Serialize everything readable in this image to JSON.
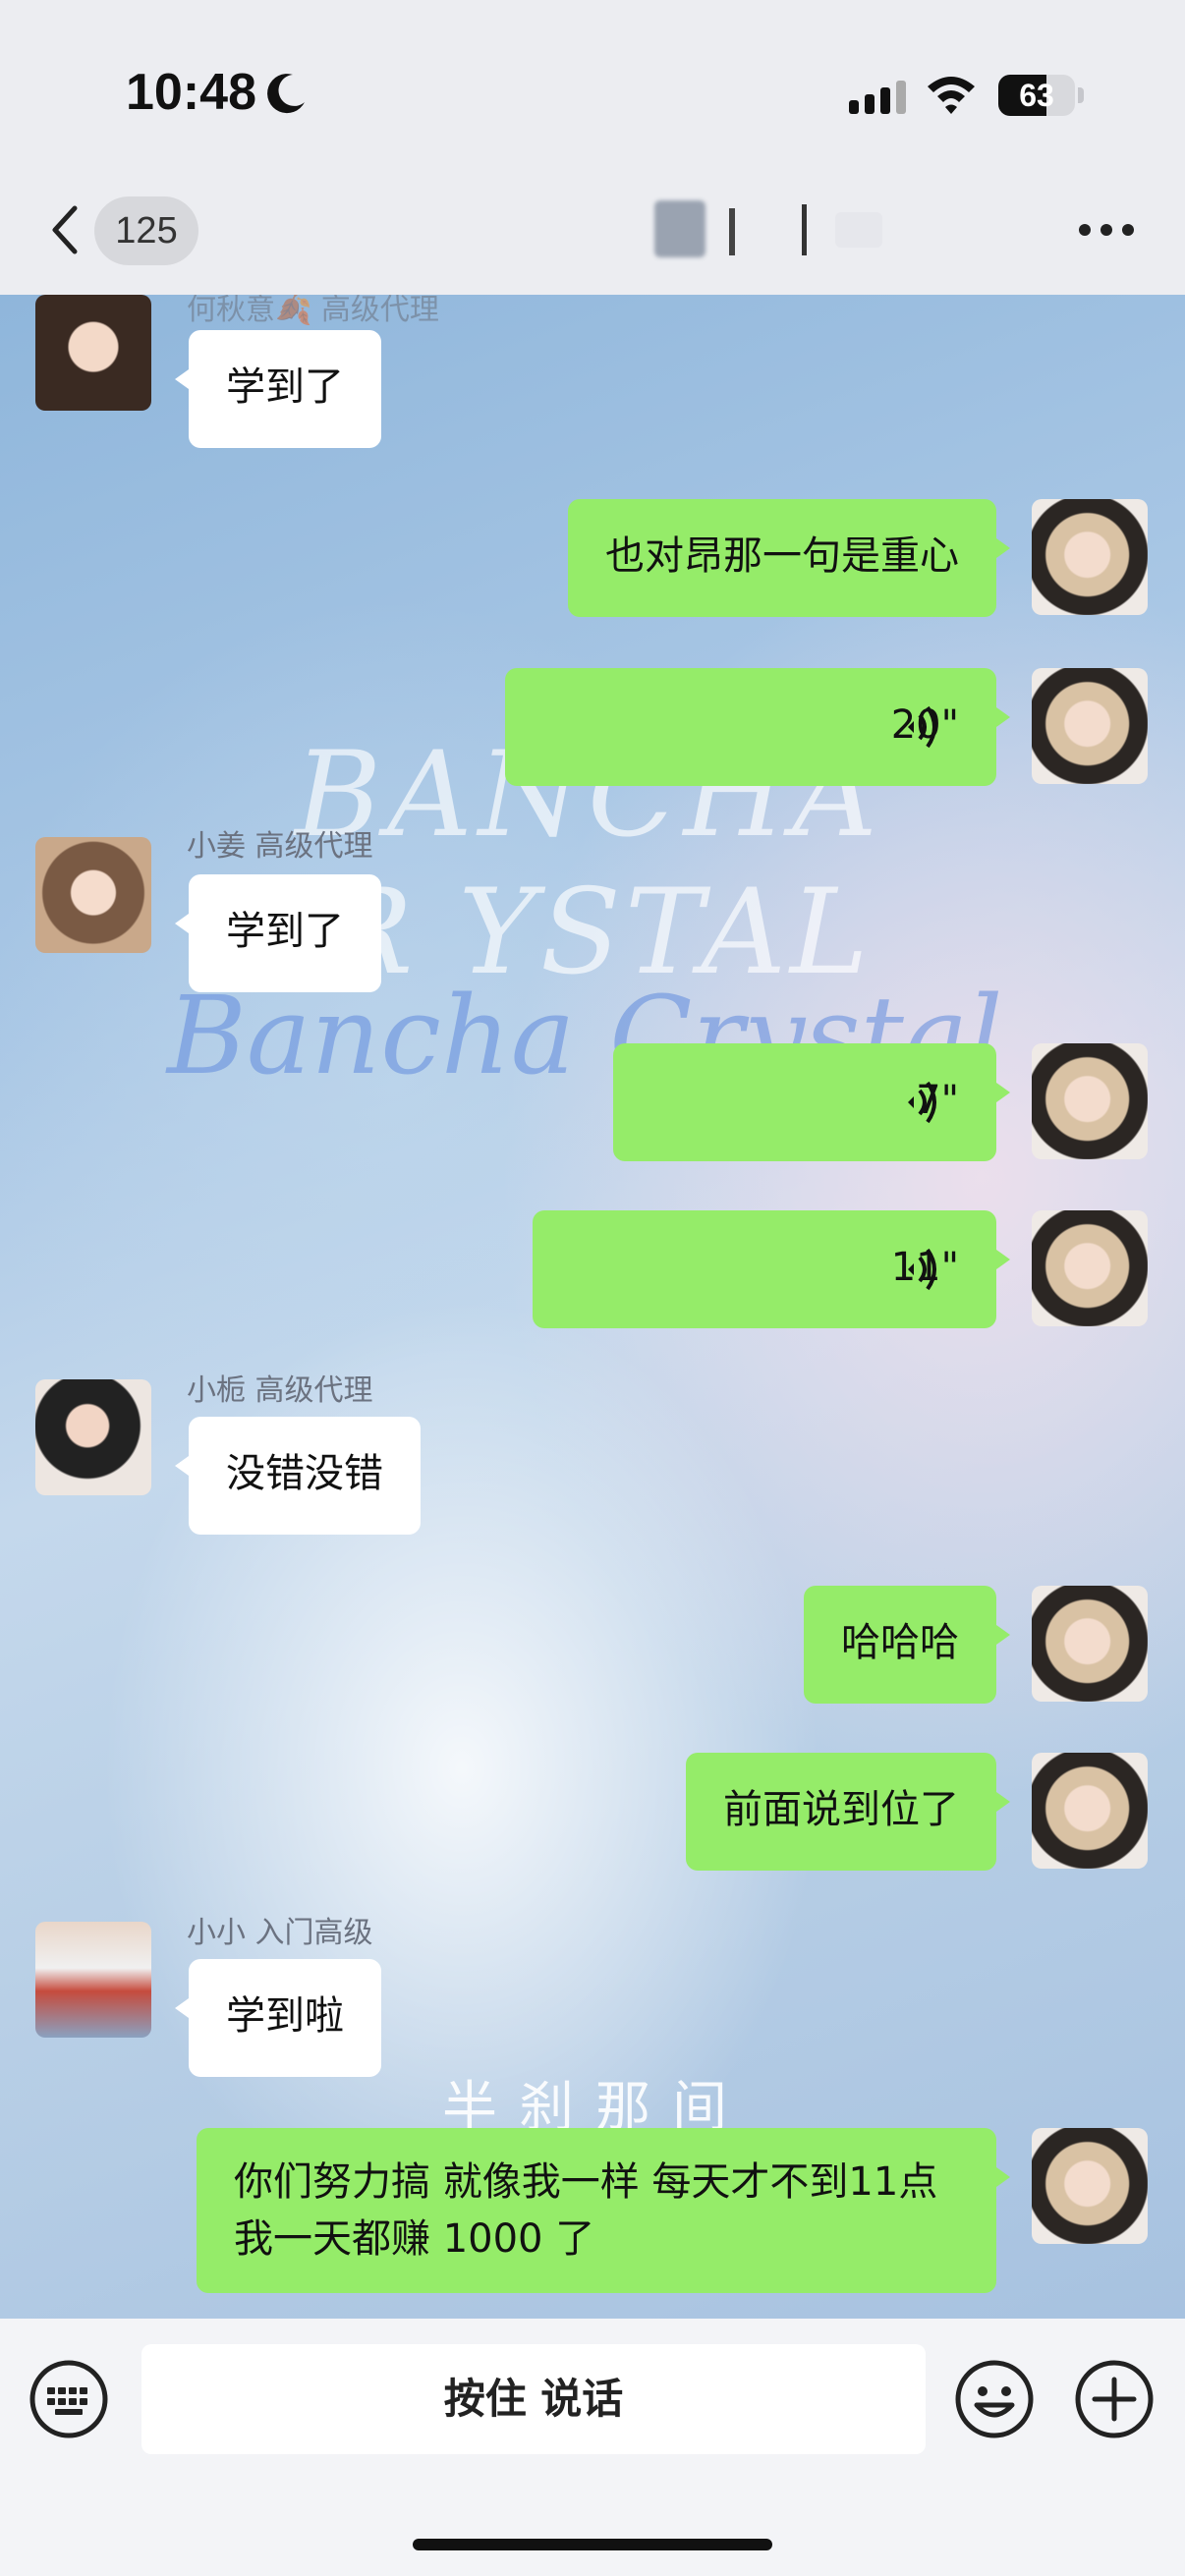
{
  "status_bar": {
    "time": "10:48",
    "battery": "63",
    "battery_level_percent": 63
  },
  "header": {
    "unread_count": "125"
  },
  "chat": {
    "watermark": [
      "BANCHA",
      "R YSTAL",
      "Bancha Crystal",
      "半刹那间"
    ],
    "partial_sender_top": "何秋意🍂 高级代理",
    "messages": [
      {
        "side": "in",
        "avatar": "avatar-girl-1",
        "text": "学到了"
      },
      {
        "side": "out",
        "text": "也对昂那一句是重心"
      },
      {
        "side": "out",
        "type": "voice",
        "duration": "20\""
      },
      {
        "side": "in",
        "sender": "小姜 高级代理",
        "avatar": "avatar-girl-2",
        "text": "学到了"
      },
      {
        "side": "out",
        "type": "voice",
        "duration": "7\""
      },
      {
        "side": "out",
        "type": "voice",
        "duration": "11\""
      },
      {
        "side": "in",
        "sender": "小栀 高级代理",
        "avatar": "avatar-girl-3",
        "text": "没错没错"
      },
      {
        "side": "out",
        "text": "哈哈哈"
      },
      {
        "side": "out",
        "text": "前面说到位了"
      },
      {
        "side": "in",
        "sender": "小小 入门高级",
        "avatar": "avatar-girl-4",
        "text": "学到啦"
      },
      {
        "side": "out",
        "text": "你们努力搞 就像我一样 每天才不到11点我一天都赚 1000 了"
      }
    ]
  },
  "input_bar": {
    "press_to_talk": "按住 说话"
  }
}
